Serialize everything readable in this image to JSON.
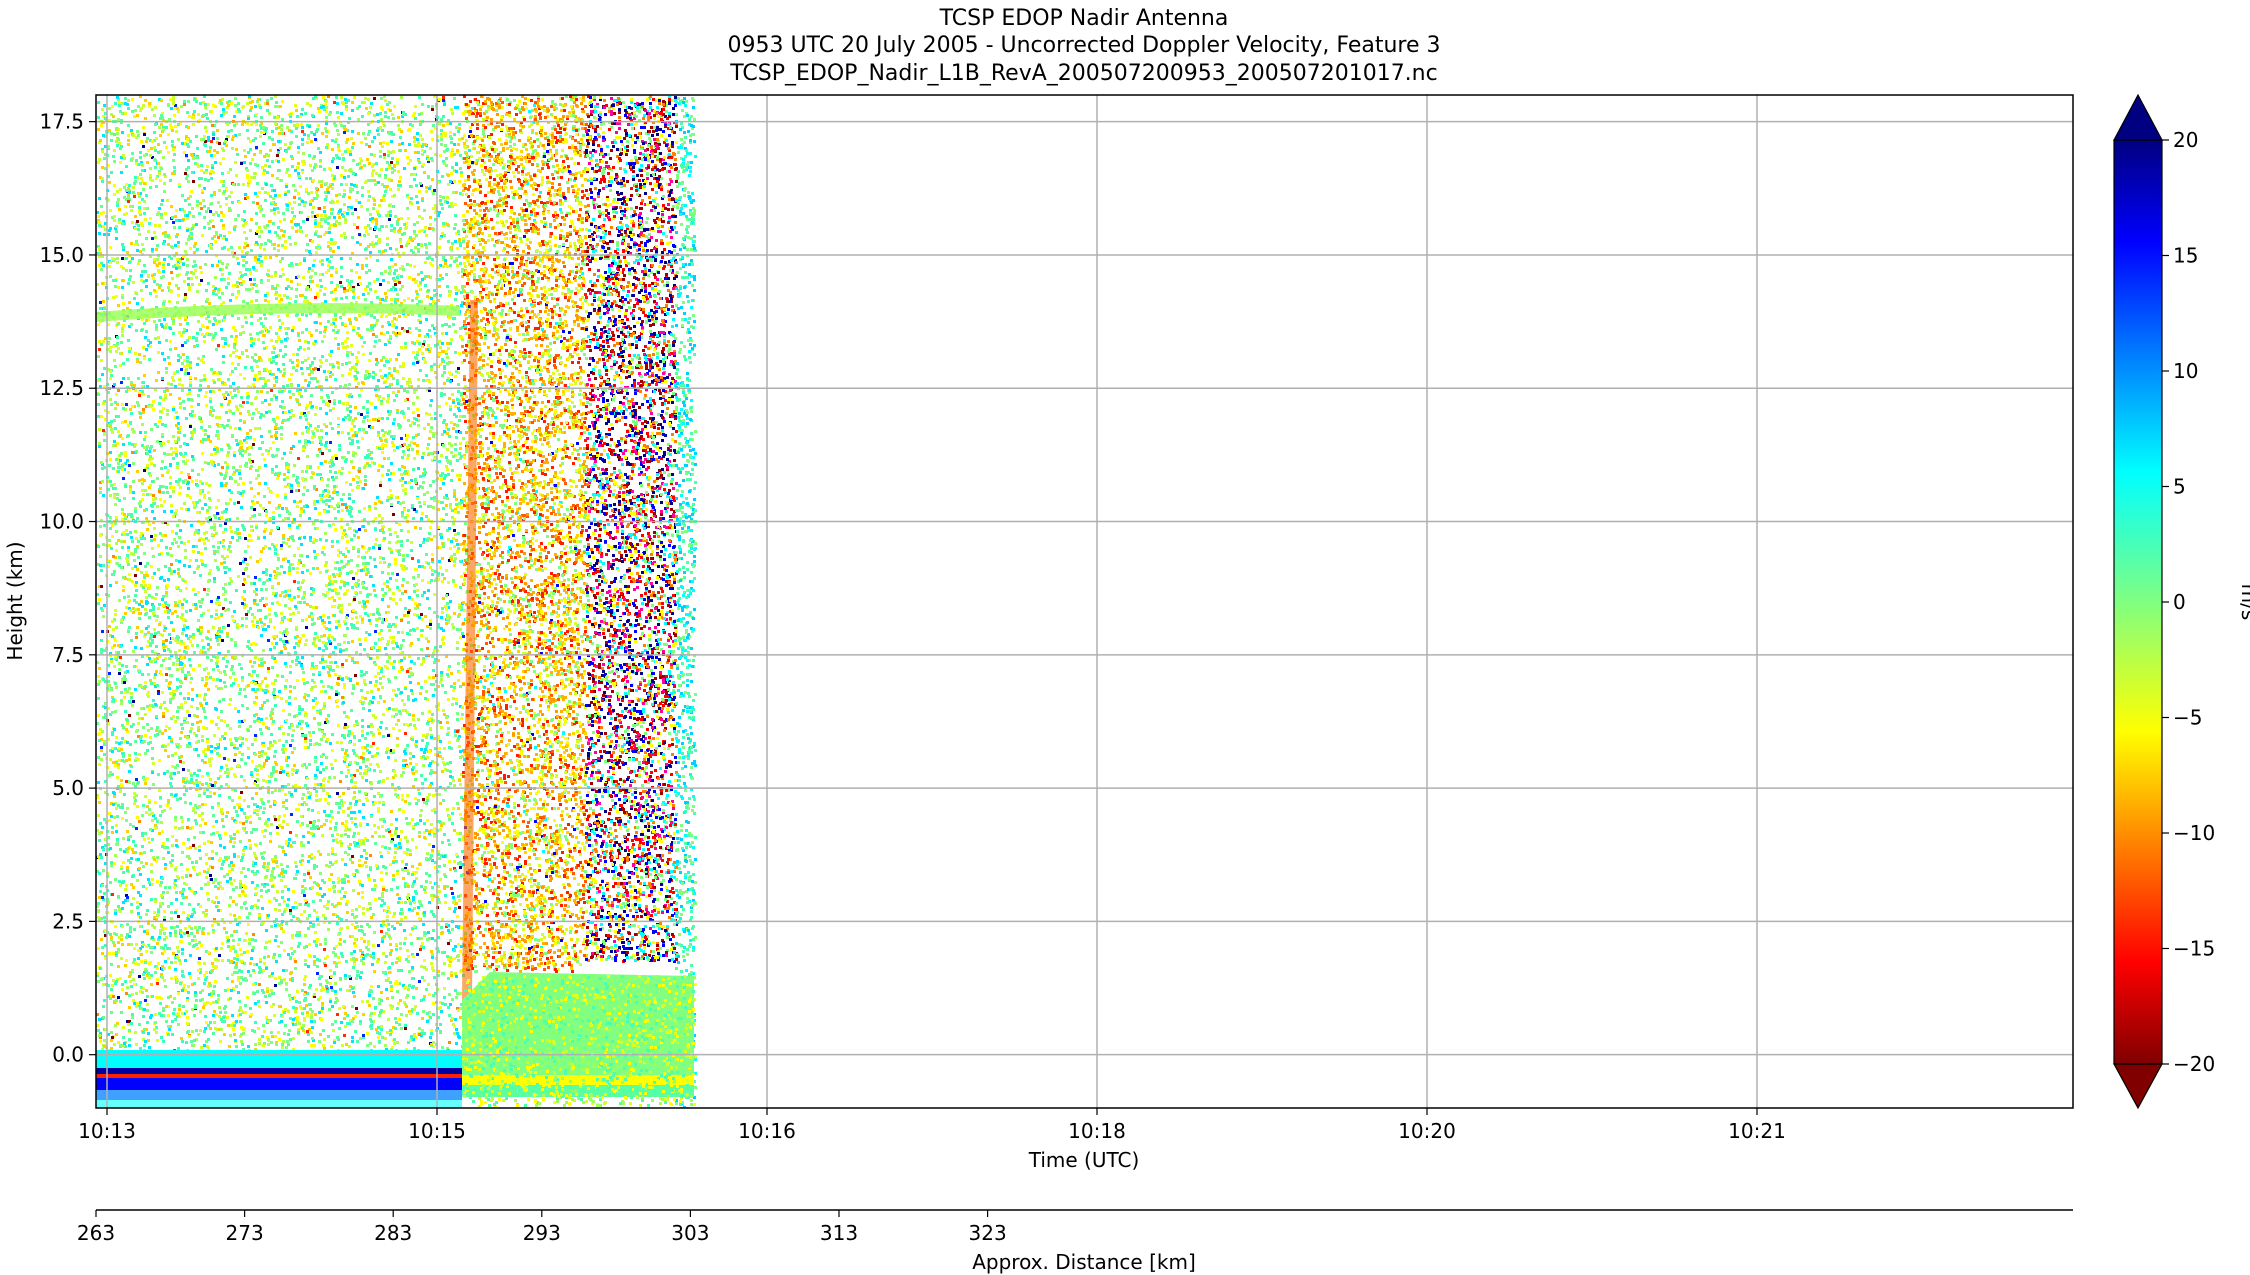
{
  "chart_data": {
    "type": "heatmap",
    "title": [
      "TCSP EDOP Nadir Antenna",
      "0953 UTC 20 July 2005 - Uncorrected Doppler Velocity, Feature 3",
      "TCSP_EDOP_Nadir_L1B_RevA_200507200953_200507201017.nc"
    ],
    "xlabel": "Time (UTC)",
    "ylabel": "Height (km)",
    "x_ticks": [
      "10:13",
      "10:15",
      "10:16",
      "10:18",
      "10:20",
      "10:21"
    ],
    "y_ticks": [
      "0.0",
      "2.5",
      "5.0",
      "7.5",
      "10.0",
      "12.5",
      "15.0",
      "17.5"
    ],
    "ylim": [
      -1.0,
      18.0
    ],
    "grid": true,
    "secondary_axis": {
      "label": "Approx. Distance [km]",
      "ticks": [
        "263",
        "273",
        "283",
        "293",
        "303",
        "313",
        "323"
      ]
    },
    "colorbar": {
      "label": "m/s",
      "ticks": [
        "−20",
        "−15",
        "−10",
        "−5",
        "0",
        "5",
        "10",
        "15",
        "20"
      ],
      "range": [
        -20,
        20
      ],
      "colormap": "jet",
      "extend": "both"
    }
  }
}
